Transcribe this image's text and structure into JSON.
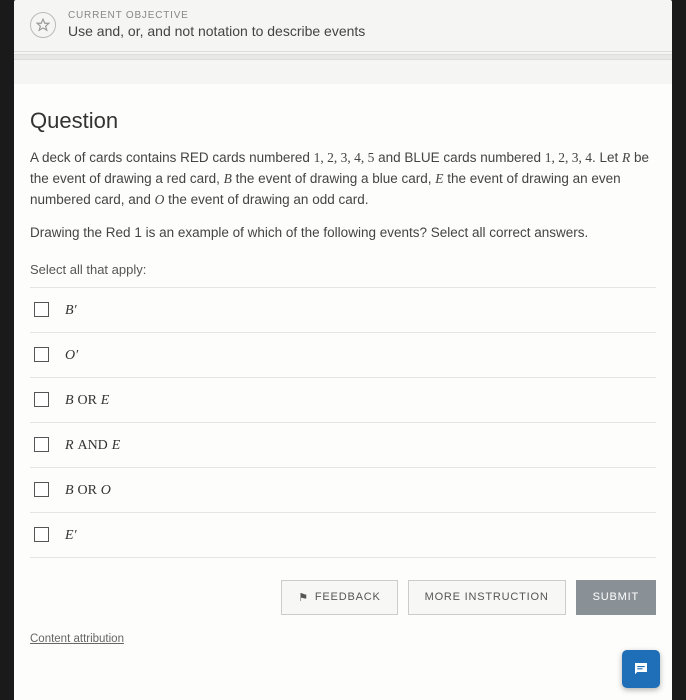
{
  "header": {
    "objective_label": "CURRENT OBJECTIVE",
    "objective_desc": "Use and, or, and not notation to describe events"
  },
  "question": {
    "title": "Question",
    "body_html": "A deck of cards contains RED cards numbered <span class='num'>1, 2, 3, 4, 5</span> and BLUE cards numbered <span class='num'>1, 2, 3, 4</span>. Let <span class='var'>R</span> be the event of drawing a red card, <span class='var'>B</span> the event of drawing a blue card, <span class='var'>E</span> the event of drawing an even numbered card, and <span class='var'>O</span> the event of drawing an odd card.",
    "sub_prompt_html": "Drawing the Red <span class='num'>1</span> is an example of which of the following events? Select all correct answers.",
    "select_label": "Select all that apply:",
    "options": [
      {
        "html": "<span class='var'>B′</span>"
      },
      {
        "html": "<span class='var'>O′</span>"
      },
      {
        "html": "<span class='var'>B</span> <span class='op'>OR</span> <span class='var'>E</span>"
      },
      {
        "html": "<span class='var'>R</span> <span class='op'>AND</span> <span class='var'>E</span>"
      },
      {
        "html": "<span class='var'>B</span> <span class='op'>OR</span> <span class='var'>O</span>"
      },
      {
        "html": "<span class='var'>E′</span>"
      }
    ]
  },
  "actions": {
    "feedback": "FEEDBACK",
    "more_instruction": "MORE INSTRUCTION",
    "submit": "SUBMIT"
  },
  "attribution": "Content attribution"
}
